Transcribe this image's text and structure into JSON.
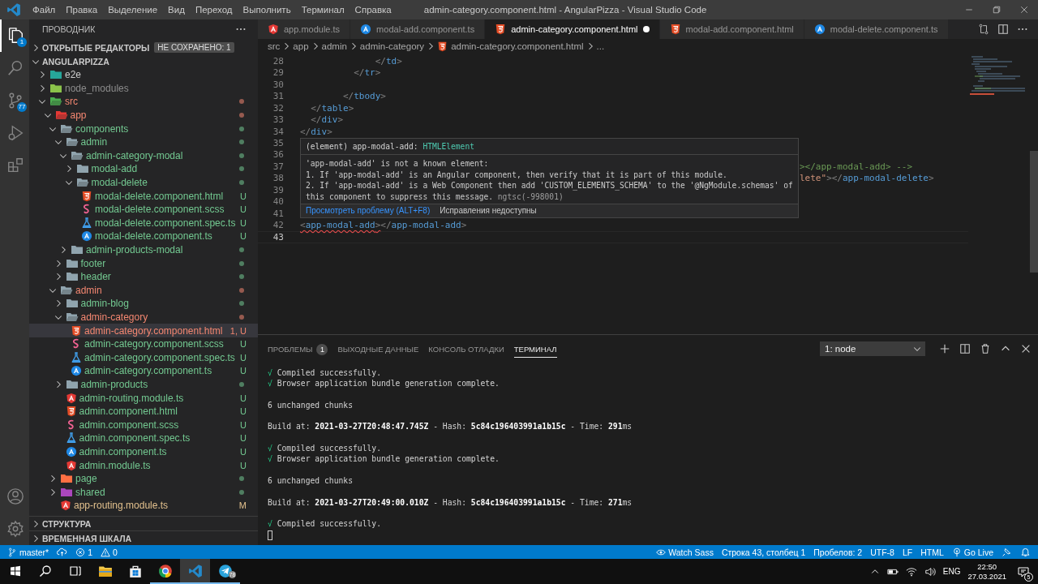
{
  "window": {
    "title": "admin-category.component.html - AngularPizza - Visual Studio Code"
  },
  "menu": [
    "Файл",
    "Правка",
    "Выделение",
    "Вид",
    "Переход",
    "Выполнить",
    "Терминал",
    "Справка"
  ],
  "activity_bar": {
    "top": [
      {
        "kind": "explorer",
        "selected": true,
        "badge": "1"
      },
      {
        "kind": "search",
        "selected": false
      },
      {
        "kind": "source-control",
        "selected": false,
        "badge": "77"
      },
      {
        "kind": "run",
        "selected": false
      },
      {
        "kind": "extensions",
        "selected": false
      }
    ],
    "bottom": [
      {
        "kind": "account"
      },
      {
        "kind": "settings"
      }
    ]
  },
  "sidebar": {
    "title": "ПРОВОДНИК",
    "open_editors": {
      "label": "ОТКРЫТЫЕ РЕДАКТОРЫ",
      "badge": "НЕ СОХРАНЕНО: 1",
      "expanded": false
    },
    "tree": {
      "name": "ANGULARPIZZA",
      "expanded": true,
      "children": [
        {
          "name": "e2e",
          "kind": "folder-test",
          "color": "#cccccc",
          "dot": false,
          "expanded": false,
          "selected": false
        },
        {
          "name": "node_modules",
          "kind": "folder-node",
          "color": "#8c8c8c",
          "dot": false,
          "expanded": false,
          "selected": false
        },
        {
          "name": "src",
          "kind": "folder-src",
          "color": "#f48771",
          "dot": true,
          "expanded": true,
          "selected": false,
          "children": [
            {
              "name": "app",
              "kind": "folder-app",
              "color": "#f48771",
              "dot": true,
              "expanded": true,
              "selected": false,
              "children": [
                {
                  "name": "components",
                  "kind": "folder",
                  "color": "#73c991",
                  "dot": true,
                  "expanded": true,
                  "selected": false,
                  "children": [
                    {
                      "name": "admin",
                      "kind": "folder",
                      "color": "#73c991",
                      "dot": true,
                      "expanded": true,
                      "selected": false,
                      "children": [
                        {
                          "name": "admin-category-modal",
                          "kind": "folder",
                          "color": "#73c991",
                          "dot": true,
                          "expanded": true,
                          "selected": false,
                          "children": [
                            {
                              "name": "modal-add",
                              "kind": "folder",
                              "color": "#73c991",
                              "dot": true,
                              "expanded": false,
                              "selected": false
                            },
                            {
                              "name": "modal-delete",
                              "kind": "folder",
                              "color": "#73c991",
                              "dot": true,
                              "expanded": true,
                              "selected": false,
                              "children": [
                                {
                                  "name": "modal-delete.component.html",
                                  "kind": "html",
                                  "color": "#73c991",
                                  "badge": "U",
                                  "selected": false
                                },
                                {
                                  "name": "modal-delete.component.scss",
                                  "kind": "scss",
                                  "color": "#73c991",
                                  "badge": "U",
                                  "selected": false
                                },
                                {
                                  "name": "modal-delete.component.spec.ts",
                                  "kind": "spec",
                                  "color": "#73c991",
                                  "badge": "U",
                                  "selected": false
                                },
                                {
                                  "name": "modal-delete.component.ts",
                                  "kind": "ts",
                                  "color": "#73c991",
                                  "badge": "U",
                                  "selected": false
                                }
                              ]
                            }
                          ]
                        },
                        {
                          "name": "admin-products-modal",
                          "kind": "folder",
                          "color": "#73c991",
                          "dot": true,
                          "expanded": false,
                          "selected": false
                        }
                      ]
                    },
                    {
                      "name": "footer",
                      "kind": "folder",
                      "color": "#73c991",
                      "dot": true,
                      "expanded": false,
                      "selected": false
                    },
                    {
                      "name": "header",
                      "kind": "folder",
                      "color": "#73c991",
                      "dot": true,
                      "expanded": false,
                      "selected": false
                    }
                  ]
                },
                {
                  "name": "admin",
                  "kind": "folder",
                  "color": "#f48771",
                  "dot": true,
                  "expanded": true,
                  "selected": false,
                  "children": [
                    {
                      "name": "admin-blog",
                      "kind": "folder",
                      "color": "#73c991",
                      "dot": true,
                      "expanded": false,
                      "selected": false
                    },
                    {
                      "name": "admin-category",
                      "kind": "folder",
                      "color": "#f48771",
                      "dot": true,
                      "expanded": true,
                      "selected": false,
                      "children": [
                        {
                          "name": "admin-category.component.html",
                          "kind": "html",
                          "color": "#f48771",
                          "badge": "1, U",
                          "selected": true
                        },
                        {
                          "name": "admin-category.component.scss",
                          "kind": "scss",
                          "color": "#73c991",
                          "badge": "U",
                          "selected": false
                        },
                        {
                          "name": "admin-category.component.spec.ts",
                          "kind": "spec",
                          "color": "#73c991",
                          "badge": "U",
                          "selected": false
                        },
                        {
                          "name": "admin-category.component.ts",
                          "kind": "ts",
                          "color": "#73c991",
                          "badge": "U",
                          "selected": false
                        }
                      ]
                    },
                    {
                      "name": "admin-products",
                      "kind": "folder",
                      "color": "#73c991",
                      "dot": true,
                      "expanded": false,
                      "selected": false
                    },
                    {
                      "name": "admin-routing.module.ts",
                      "kind": "module",
                      "color": "#73c991",
                      "badge": "U",
                      "selected": false
                    },
                    {
                      "name": "admin.component.html",
                      "kind": "html",
                      "color": "#73c991",
                      "badge": "U",
                      "selected": false
                    },
                    {
                      "name": "admin.component.scss",
                      "kind": "scss",
                      "color": "#73c991",
                      "badge": "U",
                      "selected": false
                    },
                    {
                      "name": "admin.component.spec.ts",
                      "kind": "spec",
                      "color": "#73c991",
                      "badge": "U",
                      "selected": false
                    },
                    {
                      "name": "admin.component.ts",
                      "kind": "ts",
                      "color": "#73c991",
                      "badge": "U",
                      "selected": false
                    },
                    {
                      "name": "admin.module.ts",
                      "kind": "module",
                      "color": "#73c991",
                      "badge": "U",
                      "selected": false
                    }
                  ]
                },
                {
                  "name": "page",
                  "kind": "folder-page",
                  "color": "#73c991",
                  "dot": true,
                  "expanded": false,
                  "selected": false
                },
                {
                  "name": "shared",
                  "kind": "folder-shared",
                  "color": "#73c991",
                  "dot": true,
                  "expanded": false,
                  "selected": false
                },
                {
                  "name": "app-routing.module.ts",
                  "kind": "module",
                  "color": "#e2c08d",
                  "badge": "M",
                  "selected": false
                }
              ]
            }
          ]
        }
      ]
    },
    "sections": [
      {
        "label": "СТРУКТУРА",
        "expanded": false
      },
      {
        "label": "ВРЕМЕННАЯ ШКАЛА",
        "expanded": false
      }
    ]
  },
  "tabs": [
    {
      "label": "app.module.ts",
      "kind": "module",
      "selected": false,
      "dirty": false
    },
    {
      "label": "modal-add.component.ts",
      "kind": "ts",
      "selected": false,
      "dirty": false
    },
    {
      "label": "admin-category.component.html",
      "kind": "html",
      "selected": true,
      "dirty": true
    },
    {
      "label": "modal-add.component.html",
      "kind": "html",
      "selected": false,
      "dirty": false
    },
    {
      "label": "modal-delete.component.ts",
      "kind": "ts",
      "selected": false,
      "dirty": false
    }
  ],
  "breadcrumbs": [
    {
      "label": "src",
      "kind": "folder"
    },
    {
      "label": "app",
      "kind": "folder"
    },
    {
      "label": "admin",
      "kind": "folder"
    },
    {
      "label": "admin-category",
      "kind": "folder"
    },
    {
      "label": "admin-category.component.html",
      "kind": "html"
    },
    {
      "label": "...",
      "kind": "more"
    }
  ],
  "code": [
    {
      "number": "28",
      "current": false,
      "tokens": [
        {
          "text": "              </",
          "kind": "punct"
        },
        {
          "text": "td",
          "kind": "tag"
        },
        {
          "text": ">",
          "kind": "punct"
        }
      ]
    },
    {
      "number": "29",
      "current": false,
      "tokens": [
        {
          "text": "          </",
          "kind": "punct"
        },
        {
          "text": "tr",
          "kind": "tag"
        },
        {
          "text": ">",
          "kind": "punct"
        }
      ]
    },
    {
      "number": "30",
      "current": false
    },
    {
      "number": "31",
      "current": false,
      "tokens": [
        {
          "text": "        </",
          "kind": "punct"
        },
        {
          "text": "tbody",
          "kind": "tag"
        },
        {
          "text": ">",
          "kind": "punct"
        }
      ]
    },
    {
      "number": "32",
      "current": false,
      "tokens": [
        {
          "text": "  </",
          "kind": "punct"
        },
        {
          "text": "table",
          "kind": "tag"
        },
        {
          "text": ">",
          "kind": "punct"
        }
      ]
    },
    {
      "number": "33",
      "current": false,
      "tokens": [
        {
          "text": "  </",
          "kind": "punct"
        },
        {
          "text": "div",
          "kind": "tag"
        },
        {
          "text": ">",
          "kind": "punct"
        }
      ]
    },
    {
      "number": "34",
      "current": false,
      "tokens": [
        {
          "text": "</",
          "kind": "punct"
        },
        {
          "text": "div",
          "kind": "tag"
        },
        {
          "text": ">",
          "kind": "punct"
        }
      ]
    },
    {
      "number": "35",
      "current": false
    },
    {
      "number": "36",
      "current": false
    },
    {
      "number": "37",
      "current": false,
      "covered": true,
      "tokens": [
        {
          "text": "></app-modal-add> -->",
          "kind": "comment"
        }
      ]
    },
    {
      "number": "38",
      "current": false,
      "covered": true,
      "tokens": [
        {
          "text": "lete\"",
          "kind": "string"
        },
        {
          "text": "></",
          "kind": "punct"
        },
        {
          "text": "app-modal-delete",
          "kind": "tag"
        },
        {
          "text": ">",
          "kind": "punct"
        }
      ]
    },
    {
      "number": "39",
      "current": false
    },
    {
      "number": "40",
      "current": false
    },
    {
      "number": "41",
      "current": false
    },
    {
      "number": "42",
      "current": false,
      "tokens": [
        {
          "text": "<",
          "kind": "punct-error"
        },
        {
          "text": "app-modal-add",
          "kind": "tag-error"
        },
        {
          "text": ">",
          "kind": "punct-error"
        },
        {
          "text": "</",
          "kind": "punct"
        },
        {
          "text": "app-modal-add",
          "kind": "tag"
        },
        {
          "text": ">",
          "kind": "punct"
        }
      ]
    },
    {
      "number": "43",
      "current": true
    }
  ],
  "hover": {
    "signature": [
      {
        "text": "(element) app-modal-add: ",
        "kind": "plain"
      },
      {
        "text": "HTMLElement",
        "kind": "type"
      }
    ],
    "message": [
      "'app-modal-add' is not a known element:",
      "1. If 'app-modal-add' is an Angular component, then verify that it is part of this module.",
      "2. If 'app-modal-add' is a Web Component then add 'CUSTOM_ELEMENTS_SCHEMA' to the '@NgModule.schemas' of",
      "this component to suppress this message."
    ],
    "source": "ngtsc(-998001)",
    "link": "Просмотреть проблему (ALT+F8)",
    "note": "Исправления недоступны"
  },
  "panel": {
    "tabs": [
      {
        "label": "ПРОБЛЕМЫ",
        "badge": "1",
        "selected": false
      },
      {
        "label": "ВЫХОДНЫЕ ДАННЫЕ",
        "selected": false
      },
      {
        "label": "КОНСОЛЬ ОТЛАДКИ",
        "selected": false
      },
      {
        "label": "ТЕРМИНАЛ",
        "selected": true
      }
    ],
    "terminal_select": "1: node",
    "blocks": [
      {
        "lines": [
          [
            {
              "text": "√",
              "kind": "ok"
            },
            {
              "text": " Compiled successfully.",
              "kind": "plain"
            }
          ],
          [
            {
              "text": "√",
              "kind": "ok"
            },
            {
              "text": " Browser application bundle generation complete.",
              "kind": "plain"
            }
          ]
        ]
      },
      {
        "lines": [
          [
            {
              "text": "6 unchanged chunks",
              "kind": "plain"
            }
          ]
        ]
      },
      {
        "lines": [
          [
            {
              "text": "Build at: ",
              "kind": "plain"
            },
            {
              "text": "2021-03-27T20:48:47.745Z",
              "kind": "bold"
            },
            {
              "text": " - Hash: ",
              "kind": "plain"
            },
            {
              "text": "5c84c196403991a1b15c",
              "kind": "bold"
            },
            {
              "text": " - Time: ",
              "kind": "plain"
            },
            {
              "text": "291",
              "kind": "bold"
            },
            {
              "text": "ms",
              "kind": "plain"
            }
          ]
        ]
      },
      {
        "lines": [
          [
            {
              "text": "√",
              "kind": "ok"
            },
            {
              "text": " Compiled successfully.",
              "kind": "plain"
            }
          ],
          [
            {
              "text": "√",
              "kind": "ok"
            },
            {
              "text": " Browser application bundle generation complete.",
              "kind": "plain"
            }
          ]
        ]
      },
      {
        "lines": [
          [
            {
              "text": "6 unchanged chunks",
              "kind": "plain"
            }
          ]
        ]
      },
      {
        "lines": [
          [
            {
              "text": "Build at: ",
              "kind": "plain"
            },
            {
              "text": "2021-03-27T20:49:00.010Z",
              "kind": "bold"
            },
            {
              "text": " - Hash: ",
              "kind": "plain"
            },
            {
              "text": "5c84c196403991a1b15c",
              "kind": "bold"
            },
            {
              "text": " - Time: ",
              "kind": "plain"
            },
            {
              "text": "271",
              "kind": "bold"
            },
            {
              "text": "ms",
              "kind": "plain"
            }
          ]
        ]
      },
      {
        "lines": [
          [
            {
              "text": "√",
              "kind": "ok"
            },
            {
              "text": " Compiled successfully.",
              "kind": "plain"
            }
          ]
        ]
      }
    ],
    "cursor": true
  },
  "status_bar": {
    "left": [
      {
        "kind": "branch",
        "label": "master*"
      },
      {
        "kind": "sync"
      },
      {
        "kind": "errors",
        "label": "1"
      },
      {
        "kind": "warnings",
        "label": "0"
      }
    ],
    "right": [
      {
        "kind": "eye",
        "label": "Watch Sass"
      },
      {
        "kind": "text",
        "label": "Строка 43, столбец 1"
      },
      {
        "kind": "text",
        "label": "Пробелов: 2"
      },
      {
        "kind": "text",
        "label": "UTF-8"
      },
      {
        "kind": "text",
        "label": "LF"
      },
      {
        "kind": "text",
        "label": "HTML"
      },
      {
        "kind": "broadcast",
        "label": "Go Live"
      },
      {
        "kind": "feedback"
      },
      {
        "kind": "bell"
      }
    ]
  },
  "taskbar": {
    "apps": [
      {
        "kind": "start",
        "running": false,
        "selected": false
      },
      {
        "kind": "search",
        "running": false,
        "selected": false
      },
      {
        "kind": "taskview",
        "running": false,
        "selected": false
      },
      {
        "kind": "files",
        "running": false,
        "selected": false
      },
      {
        "kind": "store",
        "running": false,
        "selected": false
      },
      {
        "kind": "browser",
        "running": true,
        "selected": false
      },
      {
        "kind": "editor",
        "running": true,
        "selected": true
      },
      {
        "kind": "messenger",
        "running": true,
        "selected": false,
        "badge": "78"
      }
    ],
    "language": "ENG",
    "time": "22:50",
    "date": "27.03.2021",
    "notifications": "5"
  }
}
